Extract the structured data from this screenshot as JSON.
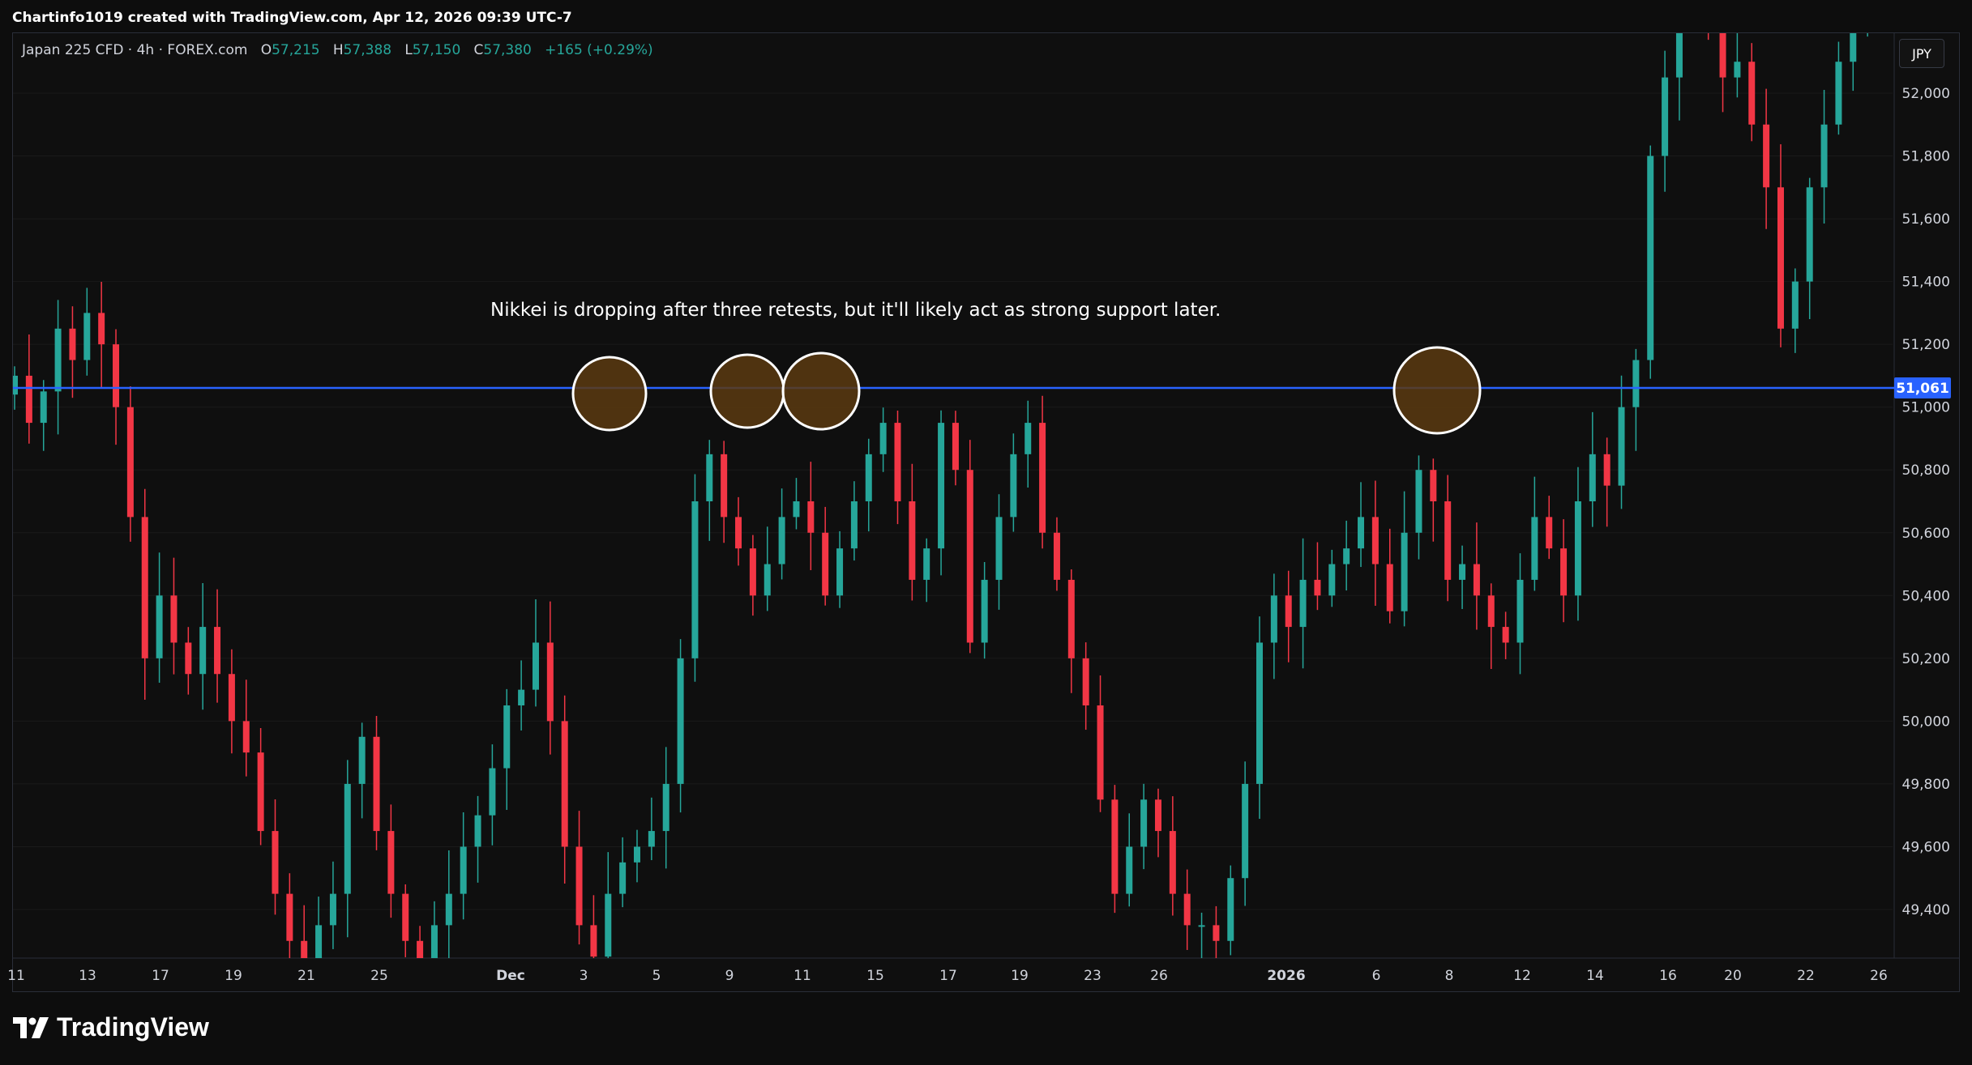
{
  "header": {
    "attribution": "Chartinfo1019 created with TradingView.com, Apr 12, 2026 09:39 UTC-7"
  },
  "legend": {
    "symbol": "Japan 225 CFD · 4h · FOREX.com",
    "open_label": "O",
    "open": "57,215",
    "high_label": "H",
    "high": "57,388",
    "low_label": "L",
    "low": "57,150",
    "close_label": "C",
    "close": "57,380",
    "change": "+165 (+0.29%)"
  },
  "currency_button": "JPY",
  "annotation_text": "Nikkei is dropping after three retests, but it'll likely act as strong support later.",
  "footer": {
    "brand": "TradingView"
  },
  "colors": {
    "up": "#26a69a",
    "down": "#f23645",
    "level_line": "#2962ff",
    "level_badge": "#2962ff",
    "circle_fill": "#5a3a10",
    "circle_stroke": "#ffffff",
    "grid": "#1a1a1a",
    "axis_text": "#d1d4dc"
  },
  "chart_data": {
    "type": "candlestick",
    "y_axis": {
      "ticks": [
        "52,000",
        "51,800",
        "51,600",
        "51,400",
        "51,200",
        "51,000",
        "50,800",
        "50,600",
        "50,400",
        "50,200",
        "50,000",
        "49,800",
        "49,600",
        "49,400"
      ],
      "ylim": [
        49250,
        52200
      ],
      "position": "right"
    },
    "x_axis": {
      "ticks": [
        "11",
        "13",
        "17",
        "19",
        "21",
        "25",
        "Dec",
        "3",
        "5",
        "9",
        "11",
        "15",
        "17",
        "19",
        "23",
        "26",
        "2026",
        "6",
        "8",
        "12",
        "14",
        "16",
        "20",
        "22",
        "26"
      ],
      "bold_ticks": [
        "Dec",
        "2026"
      ]
    },
    "level": {
      "value": 51061,
      "label": "51,061"
    },
    "retest_markers": [
      "Dec 3",
      "Dec 9",
      "Dec 11",
      "Jan 7"
    ],
    "series": [
      {
        "name": "Japan 225 CFD",
        "ohlc_close": [
          51100,
          50950,
          51050,
          51250,
          51150,
          51300,
          51200,
          51000,
          50650,
          50200,
          50400,
          50250,
          50150,
          50300,
          50150,
          50000,
          49900,
          49650,
          49450,
          49300,
          49200,
          49350,
          49450,
          49800,
          49950,
          49650,
          49450,
          49300,
          49200,
          49350,
          49450,
          49600,
          49700,
          49850,
          50050,
          50100,
          50250,
          50000,
          49600,
          49350,
          49250,
          49450,
          49550,
          49600,
          49650,
          49800,
          50200,
          50700,
          50850,
          50650,
          50550,
          50400,
          50500,
          50650,
          50700,
          50600,
          50400,
          50550,
          50700,
          50850,
          50950,
          50700,
          50450,
          50550,
          50950,
          50800,
          50250,
          50450,
          50650,
          50850,
          50950,
          50600,
          50450,
          50200,
          50050,
          49750,
          49450,
          49600,
          49750,
          49650,
          49450,
          49350,
          49350,
          49300,
          49500,
          49800,
          50250,
          50400,
          50300,
          50450,
          50400,
          50500,
          50550,
          50650,
          50500,
          50350,
          50600,
          50800,
          50700,
          50450,
          50500,
          50400,
          50300,
          50250,
          50450,
          50650,
          50550,
          50400,
          50700,
          50850,
          50750,
          51000,
          51150,
          51800,
          52050,
          52250,
          52300,
          52200,
          52050,
          52100,
          51900,
          51700,
          51250,
          51400,
          51700,
          51900,
          52100,
          52300,
          52400,
          52450
        ]
      }
    ]
  }
}
